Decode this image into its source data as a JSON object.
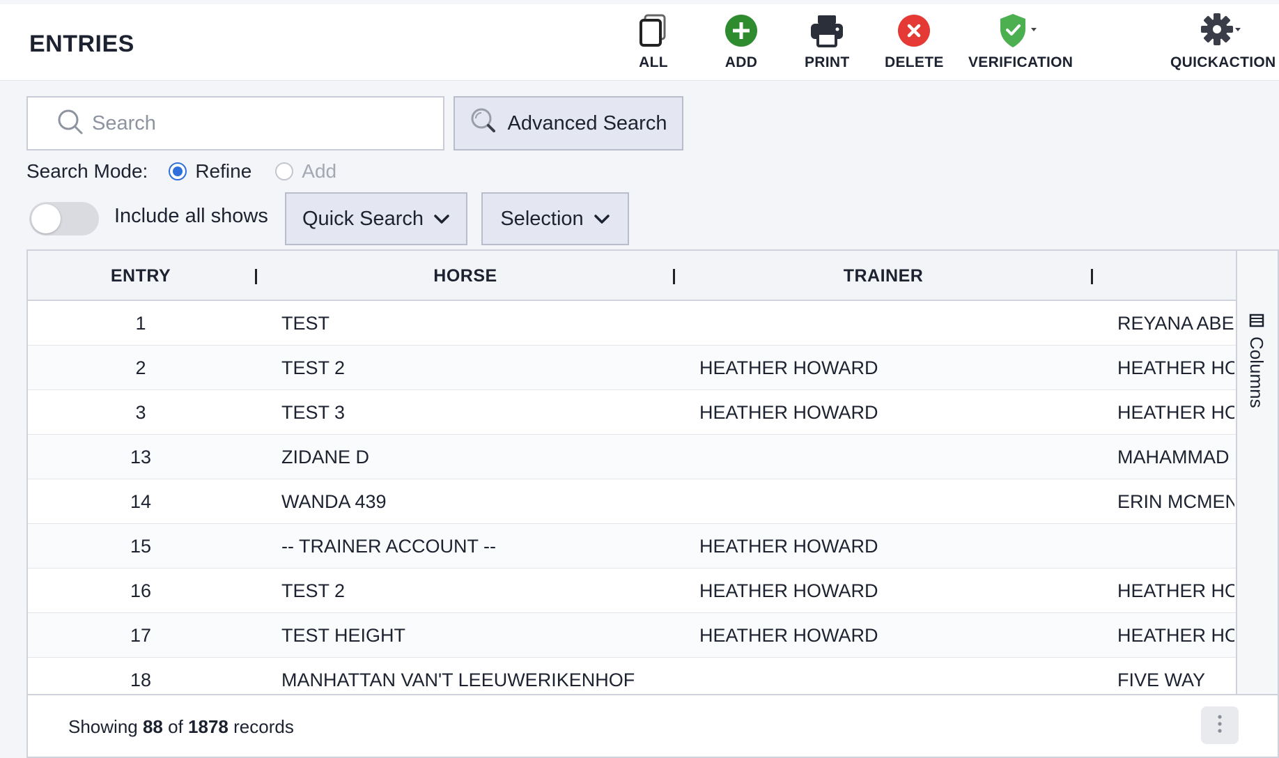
{
  "header": {
    "title": "ENTRIES",
    "tools": [
      {
        "label": "ALL",
        "icon": "copy-icon"
      },
      {
        "label": "ADD",
        "icon": "plus-circle-icon"
      },
      {
        "label": "PRINT",
        "icon": "printer-icon"
      },
      {
        "label": "DELETE",
        "icon": "x-circle-icon"
      },
      {
        "label": "VERIFICATION",
        "icon": "shield-check-icon"
      },
      {
        "label": "QUICKACTION",
        "icon": "gear-icon"
      }
    ]
  },
  "search": {
    "placeholder": "Search",
    "value": "",
    "advanced_label": "Advanced Search"
  },
  "search_mode": {
    "label": "Search Mode:",
    "options": [
      {
        "label": "Refine",
        "selected": true
      },
      {
        "label": "Add",
        "selected": false
      }
    ]
  },
  "filters": {
    "include_all_shows_label": "Include all shows",
    "include_all_shows_on": false,
    "quick_search_label": "Quick Search",
    "selection_label": "Selection"
  },
  "grid": {
    "columns": [
      "ENTRY",
      "HORSE",
      "TRAINER",
      ""
    ],
    "rows": [
      {
        "entry": "1",
        "horse": "TEST",
        "trainer": "",
        "owner": "REYANA ABE"
      },
      {
        "entry": "2",
        "horse": "TEST 2",
        "trainer": "HEATHER HOWARD",
        "owner": "HEATHER HO"
      },
      {
        "entry": "3",
        "horse": "TEST 3",
        "trainer": "HEATHER HOWARD",
        "owner": "HEATHER HO"
      },
      {
        "entry": "13",
        "horse": "ZIDANE D",
        "trainer": "",
        "owner": "MAHAMMAD"
      },
      {
        "entry": "14",
        "horse": "WANDA 439",
        "trainer": "",
        "owner": "ERIN MCMEN"
      },
      {
        "entry": "15",
        "horse": "-- TRAINER ACCOUNT --",
        "trainer": "HEATHER HOWARD",
        "owner": ""
      },
      {
        "entry": "16",
        "horse": "TEST 2",
        "trainer": "HEATHER HOWARD",
        "owner": "HEATHER HO"
      },
      {
        "entry": "17",
        "horse": "TEST HEIGHT",
        "trainer": "HEATHER HOWARD",
        "owner": "HEATHER HO"
      },
      {
        "entry": "18",
        "horse": "MANHATTAN VAN'T LEEUWERIKENHOF",
        "trainer": "",
        "owner": "FIVE WAY"
      }
    ],
    "side_panel_label": "Columns"
  },
  "footer": {
    "prefix": "Showing",
    "shown": "88",
    "of": "of",
    "total": "1878",
    "suffix": "records"
  },
  "colors": {
    "add_green": "#2e8b2e",
    "delete_red": "#e53935",
    "verify_green": "#4caf50",
    "radio_blue": "#2f6fdb",
    "button_bg": "#e4e6f2"
  }
}
